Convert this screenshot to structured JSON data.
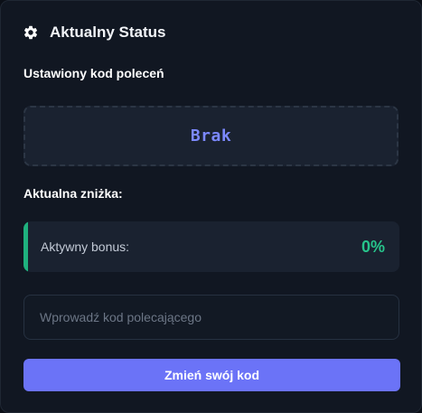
{
  "header": {
    "icon": "gear-icon",
    "title": "Aktualny Status"
  },
  "referral": {
    "label": "Ustawiony kod poleceń",
    "current_code": "Brak"
  },
  "discount": {
    "label": "Aktualna zniżka:",
    "bonus_label": "Aktywny bonus:",
    "bonus_value": "0%",
    "accent_color": "#1fb17e"
  },
  "input": {
    "placeholder": "Wprowadź kod polecającego",
    "value": ""
  },
  "action": {
    "button_label": "Zmień swój kod",
    "color": "#6b73f7"
  }
}
